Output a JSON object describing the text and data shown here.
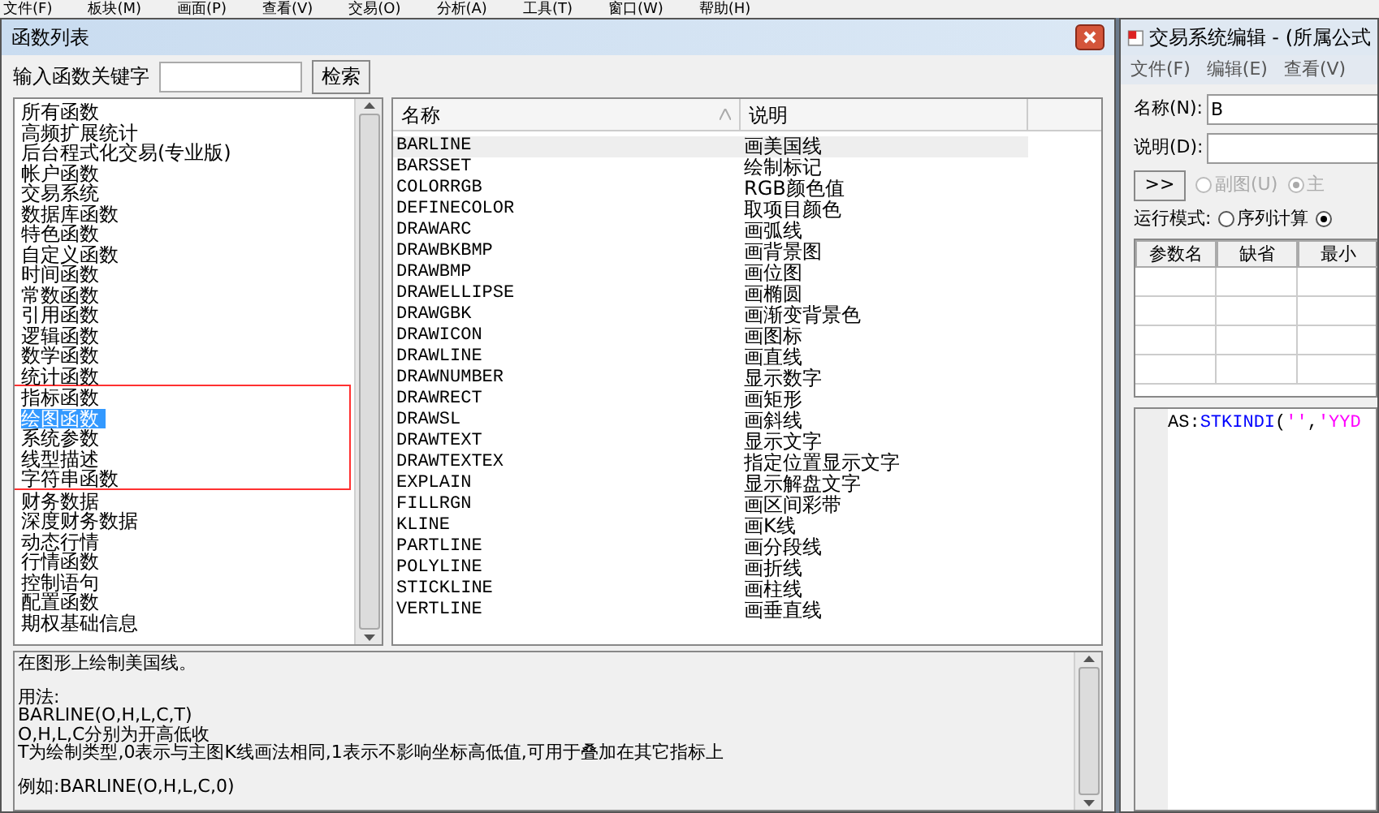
{
  "menu_bar": [
    "文件(F)",
    "板块(M)",
    "画面(P)",
    "查看(V)",
    "交易(O)",
    "分析(A)",
    "工具(T)",
    "窗口(W)",
    "帮助(H)"
  ],
  "dialog": {
    "title": "函数列表",
    "search": {
      "label": "输入函数关键字",
      "button": "检索"
    },
    "categories": [
      {
        "label": "所有函数",
        "selected": false,
        "boxed": false
      },
      {
        "label": "高频扩展统计",
        "selected": false,
        "boxed": false
      },
      {
        "label": "后台程式化交易(专业版)",
        "selected": false,
        "boxed": false
      },
      {
        "label": "帐户函数",
        "selected": false,
        "boxed": false
      },
      {
        "label": "交易系统",
        "selected": false,
        "boxed": false
      },
      {
        "label": "数据库函数",
        "selected": false,
        "boxed": false
      },
      {
        "label": "特色函数",
        "selected": false,
        "boxed": false
      },
      {
        "label": "自定义函数",
        "selected": false,
        "boxed": false
      },
      {
        "label": "时间函数",
        "selected": false,
        "boxed": false
      },
      {
        "label": "常数函数",
        "selected": false,
        "boxed": false
      },
      {
        "label": "引用函数",
        "selected": false,
        "boxed": false
      },
      {
        "label": "逻辑函数",
        "selected": false,
        "boxed": false
      },
      {
        "label": "数学函数",
        "selected": false,
        "boxed": false
      },
      {
        "label": "统计函数",
        "selected": false,
        "boxed": false
      },
      {
        "label": "指标函数",
        "selected": false,
        "boxed": true
      },
      {
        "label": "绘图函数",
        "selected": true,
        "boxed": true
      },
      {
        "label": "系统参数",
        "selected": false,
        "boxed": true
      },
      {
        "label": "线型描述",
        "selected": false,
        "boxed": true
      },
      {
        "label": "字符串函数",
        "selected": false,
        "boxed": true
      },
      {
        "label": "财务数据",
        "selected": false,
        "boxed": false
      },
      {
        "label": "深度财务数据",
        "selected": false,
        "boxed": false
      },
      {
        "label": "动态行情",
        "selected": false,
        "boxed": false
      },
      {
        "label": "行情函数",
        "selected": false,
        "boxed": false
      },
      {
        "label": "控制语句",
        "selected": false,
        "boxed": false
      },
      {
        "label": "配置函数",
        "selected": false,
        "boxed": false
      },
      {
        "label": "期权基础信息",
        "selected": false,
        "boxed": false
      }
    ],
    "table": {
      "columns": [
        {
          "label": "名称",
          "sorted": true
        },
        {
          "label": "说明",
          "sorted": false
        }
      ],
      "rows": [
        {
          "name": "BARLINE",
          "description": "画美国线",
          "selected": true
        },
        {
          "name": "BARSSET",
          "description": "绘制标记",
          "selected": false
        },
        {
          "name": "COLORRGB",
          "description": "RGB颜色值",
          "selected": false
        },
        {
          "name": "DEFINECOLOR",
          "description": "取项目颜色",
          "selected": false
        },
        {
          "name": "DRAWARC",
          "description": "画弧线",
          "selected": false
        },
        {
          "name": "DRAWBKBMP",
          "description": "画背景图",
          "selected": false
        },
        {
          "name": "DRAWBMP",
          "description": "画位图",
          "selected": false
        },
        {
          "name": "DRAWELLIPSE",
          "description": "画椭圆",
          "selected": false
        },
        {
          "name": "DRAWGBK",
          "description": "画渐变背景色",
          "selected": false
        },
        {
          "name": "DRAWICON",
          "description": "画图标",
          "selected": false
        },
        {
          "name": "DRAWLINE",
          "description": "画直线",
          "selected": false
        },
        {
          "name": "DRAWNUMBER",
          "description": "显示数字",
          "selected": false
        },
        {
          "name": "DRAWRECT",
          "description": "画矩形",
          "selected": false
        },
        {
          "name": "DRAWSL",
          "description": "画斜线",
          "selected": false
        },
        {
          "name": "DRAWTEXT",
          "description": "显示文字",
          "selected": false
        },
        {
          "name": "DRAWTEXTEX",
          "description": "指定位置显示文字",
          "selected": false
        },
        {
          "name": "EXPLAIN",
          "description": "显示解盘文字",
          "selected": false
        },
        {
          "name": "FILLRGN",
          "description": "画区间彩带",
          "selected": false
        },
        {
          "name": "KLINE",
          "description": "画K线",
          "selected": false
        },
        {
          "name": "PARTLINE",
          "description": "画分段线",
          "selected": false
        },
        {
          "name": "POLYLINE",
          "description": "画折线",
          "selected": false
        },
        {
          "name": "STICKLINE",
          "description": "画柱线",
          "selected": false
        },
        {
          "name": "VERTLINE",
          "description": "画垂直线",
          "selected": false
        }
      ]
    },
    "help_paragraphs": [
      [
        "在图形上绘制美国线。"
      ],
      [
        "用法:",
        "BARLINE(O,H,L,C,T)",
        "O,H,L,C分别为开高低收",
        "T为绘制类型,0表示与主图K线画法相同,1表示不影响坐标高低值,可用于叠加在其它指标上"
      ],
      [
        "例如:BARLINE(O,H,L,C,0)"
      ]
    ]
  },
  "editor": {
    "title": "交易系统编辑 - (所属公式",
    "menu": [
      "文件(F)",
      "编辑(E)",
      "查看(V)"
    ],
    "name_field": {
      "label": "名称(N):",
      "value": "B"
    },
    "desc_field": {
      "label": "说明(D):"
    },
    "expand_button": ">>",
    "chart_options": [
      {
        "label": "副图(U)",
        "selected": false,
        "disabled": true
      },
      {
        "label": "主",
        "selected": true,
        "disabled": true
      }
    ],
    "run_mode": {
      "label": "运行模式:",
      "options": [
        {
          "label": "序列计算",
          "selected": false
        },
        {
          "selected": true
        }
      ]
    },
    "param_columns": [
      "参数名",
      "缺省",
      "最小"
    ],
    "code_tokens": [
      {
        "text": "AS:",
        "kind": "plain"
      },
      {
        "text": "STKINDI",
        "kind": "function"
      },
      {
        "text": "(",
        "kind": "plain"
      },
      {
        "text": "''",
        "kind": "string"
      },
      {
        "text": ",",
        "kind": "plain"
      },
      {
        "text": "'YYD",
        "kind": "string"
      }
    ]
  }
}
